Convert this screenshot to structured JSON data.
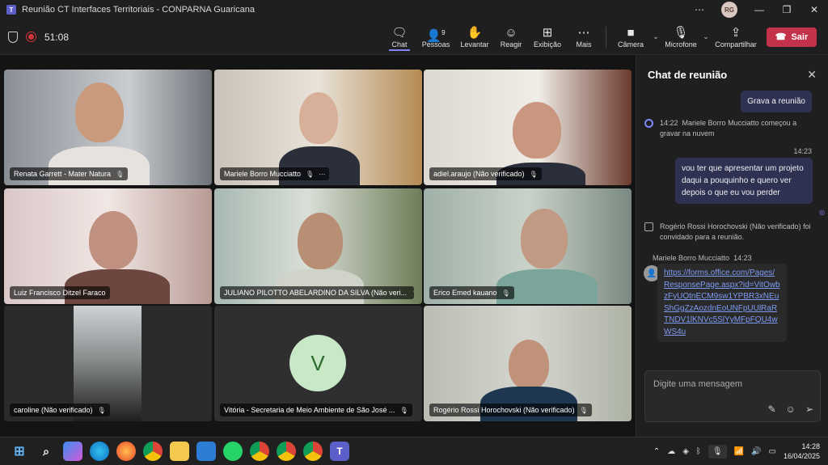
{
  "window": {
    "title": "Reunião CT Interfaces Territoriais - CONPARNA Guaricana",
    "user_initials": "RG"
  },
  "meeting": {
    "timer": "51:08",
    "tools": [
      {
        "label": "Chat",
        "icon": "chat-icon",
        "glyph": "💬",
        "active": true
      },
      {
        "label": "Pessoas",
        "icon": "people-icon",
        "glyph": "👥",
        "badge": "9"
      },
      {
        "label": "Levantar",
        "icon": "raise-hand-icon",
        "glyph": "✋"
      },
      {
        "label": "Reagir",
        "icon": "react-icon",
        "glyph": "☺"
      },
      {
        "label": "Exibição",
        "icon": "view-icon",
        "glyph": "⊞"
      },
      {
        "label": "Mais",
        "icon": "more-icon",
        "glyph": "⋯"
      }
    ],
    "camera_label": "Câmera",
    "mic_label": "Microfone",
    "share_label": "Compartilhar",
    "leave_label": "Sair"
  },
  "participants": [
    {
      "name": "Renata Garrett - Mater Natura"
    },
    {
      "name": "Mariele Borro Mucciatto"
    },
    {
      "name": "adiel.araujo (Não verificado)"
    },
    {
      "name": "Luiz Francisco Ditzel Faraco"
    },
    {
      "name": "JULIANO PILOTTO ABELARDINO DA SILVA (Não veri..."
    },
    {
      "name": "Erico Emed kauano"
    },
    {
      "name": "caroline (Não verificado)"
    },
    {
      "name": "Vitória - Secretaria de Meio Ambiente de São José ...",
      "initial": "V"
    },
    {
      "name": "Rogério Rossi Horochovski (Não verificado)"
    }
  ],
  "chat": {
    "title": "Chat de reunião",
    "messages": {
      "m1": "Grava a reunião",
      "sys1_time": "14:22",
      "sys1_text": "Mariele Borro Mucciatto começou a gravar na nuvem",
      "m2_time": "14:23",
      "m2": "vou ter que apresentar um projeto daqui a pouquinho e quero ver depois o que eu vou perder",
      "sys2_text": "Rogério Rossi Horochovski (Não verificado) foi convidado para a reunião.",
      "m3_author": "Mariele Borro Mucciatto",
      "m3_time": "14:23",
      "m3_link": "https://forms.office.com/Pages/ResponsePage.aspx?id=VitOwbzFyUOtnECM9sw1YPBR3xNEuShGgZzAozdnEoUNFpUUlRaRTNDV1lKNVc5SlYyMFpFQU4wWS4u"
    },
    "compose_placeholder": "Digite uma mensagem"
  },
  "taskbar": {
    "time": "14:28",
    "date": "16/04/2025"
  }
}
